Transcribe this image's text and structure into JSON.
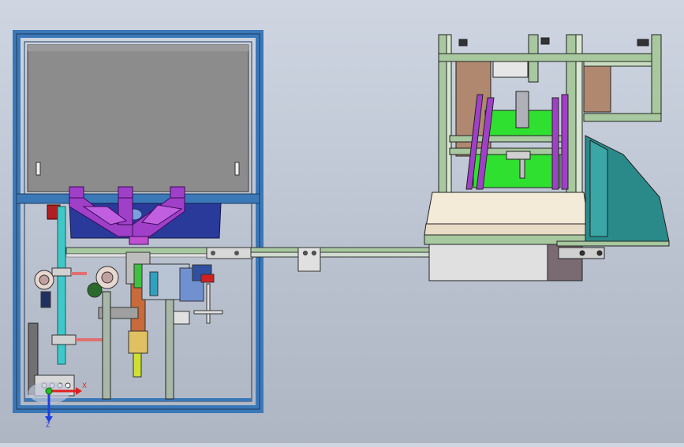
{
  "viewport": {
    "background_top": "#cfd6e2",
    "background_bottom": "#aeb6c4"
  },
  "triad": {
    "x_label": "X",
    "z_label": "Z",
    "x_color": "#e02020",
    "z_color": "#2040e0",
    "origin_color": "#20c020"
  },
  "colors": {
    "frame_blue": "#3b78b8",
    "hopper_gray": "#8c8c8c",
    "funnel_purple": "#a040c8",
    "bowl_blue": "#2a3a9a",
    "aluminum_green": "#a8c8a0",
    "cyan_rod": "#40c8c8",
    "green_plate": "#30e030",
    "tan_cover": "#f4ead8",
    "teal_chute": "#2a8a8a",
    "brown_panel": "#b08870"
  }
}
